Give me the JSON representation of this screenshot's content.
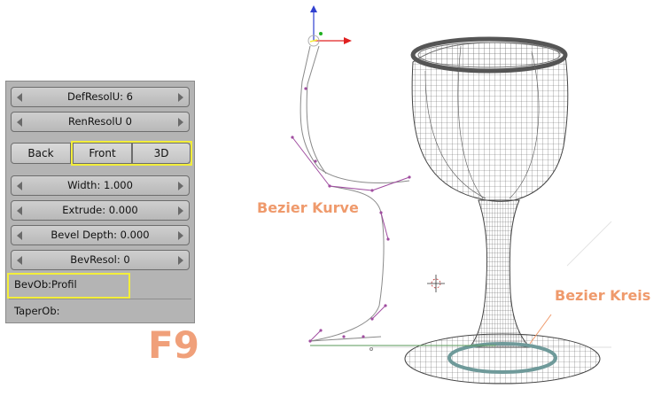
{
  "panel": {
    "def_resol": "DefResolU: 6",
    "ren_resol": "RenResolU 0",
    "back": "Back",
    "front": "Front",
    "three_d": "3D",
    "width": "Width: 1.000",
    "extrude": "Extrude: 0.000",
    "bevel_depth": "Bevel Depth: 0.000",
    "bev_resol": "BevResol: 0",
    "bev_ob": "BevOb:Profil",
    "taper_ob": "TaperOb:"
  },
  "hotkey": "F9",
  "annotations": {
    "curve": "Bezier Kurve",
    "circle": "Bezier Kreis"
  },
  "colors": {
    "highlight": "#f3ee3a",
    "annotation": "#ef9a6c",
    "curve": "#a04da0",
    "circle_ring": "#6f9a9a"
  },
  "icons": [
    "axis-gizmo-icon",
    "3d-cursor-icon"
  ]
}
